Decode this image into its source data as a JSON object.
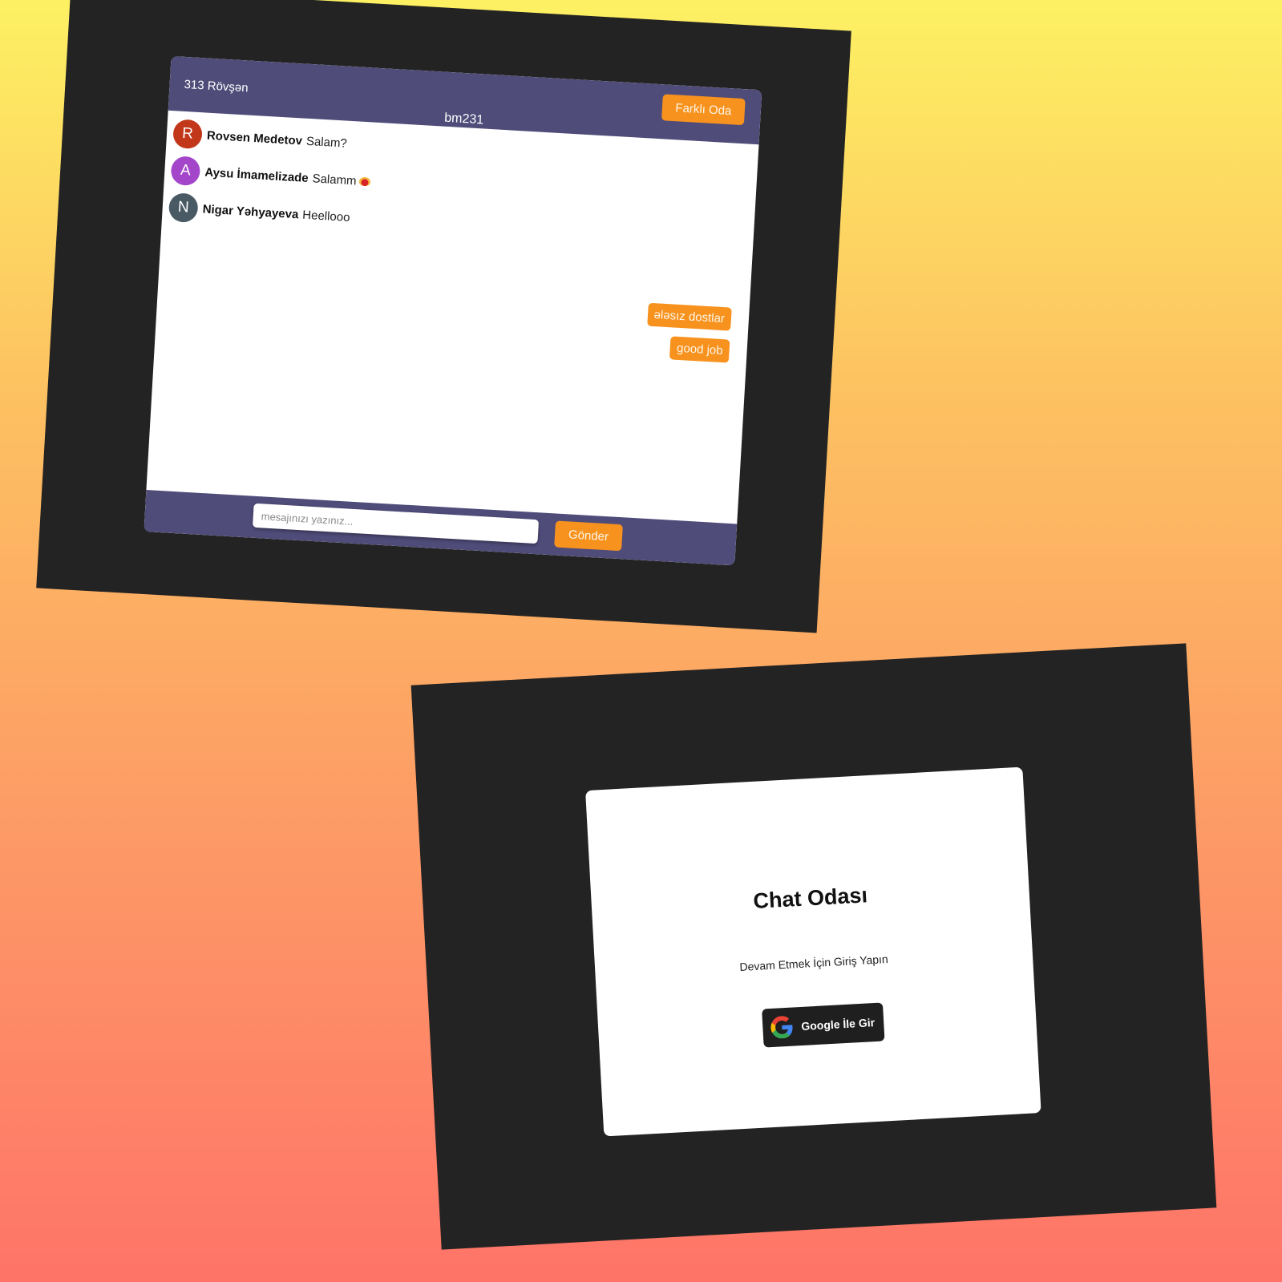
{
  "chat": {
    "user_label": "313 Rövşən",
    "room_name": "bm231",
    "change_room_label": "Farklı Oda",
    "messages": [
      {
        "initial": "R",
        "avatar_color": "#c2371a",
        "name": "Rovsen Medetov",
        "text": "Salam?",
        "emoji": false
      },
      {
        "initial": "A",
        "avatar_color": "#a346c9",
        "name": "Aysu İmamelizade",
        "text": "Salamm",
        "emoji": true
      },
      {
        "initial": "N",
        "avatar_color": "#4a5a64",
        "name": "Nigar Yəhyayeva",
        "text": "Heellooo",
        "emoji": false
      }
    ],
    "own_messages": [
      "ələsız dostlar",
      "good job"
    ],
    "input_placeholder": "mesajınızı yazınız...",
    "send_label": "Gönder"
  },
  "login": {
    "title": "Chat Odası",
    "subtitle": "Devam Etmek İçin Giriş Yapın",
    "google_button_label": "Google İle Gir"
  },
  "colors": {
    "header": "#504c7a",
    "accent": "#f7921e",
    "frame": "#232323"
  }
}
